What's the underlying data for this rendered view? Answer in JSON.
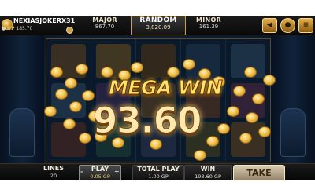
{
  "player": {
    "name": "NEXIASJOKERX31",
    "gp_label": "GP",
    "balance": "185.70"
  },
  "jackpots": {
    "major": {
      "label": "MAJOR",
      "value": "867.70"
    },
    "random": {
      "label": "RANDOM",
      "value": "3,820.09"
    },
    "minor": {
      "label": "MINOR",
      "value": "161.39"
    }
  },
  "controls": {
    "sound_icon": "speaker-icon",
    "info_icon": "info-icon",
    "menu_icon": "menu-icon",
    "sound_glyph": "◀",
    "info_glyph": "●",
    "menu_glyph": "≡"
  },
  "banner": {
    "title": "MEGA WIN",
    "amount": "93.60"
  },
  "bottom": {
    "lines_label": "LINES",
    "lines_value": "20",
    "play_label": "PLAY",
    "play_value": "0.05 GP",
    "play_minus": "-",
    "play_plus": "+",
    "total_label": "TOTAL PLAY",
    "total_value": "1.00 GP",
    "win_label": "WIN",
    "win_value": "193.60 GP",
    "take_label": "TAKE"
  },
  "colors": {
    "accent_gold": "#e8c36a",
    "win_text": "#ffe46a"
  }
}
